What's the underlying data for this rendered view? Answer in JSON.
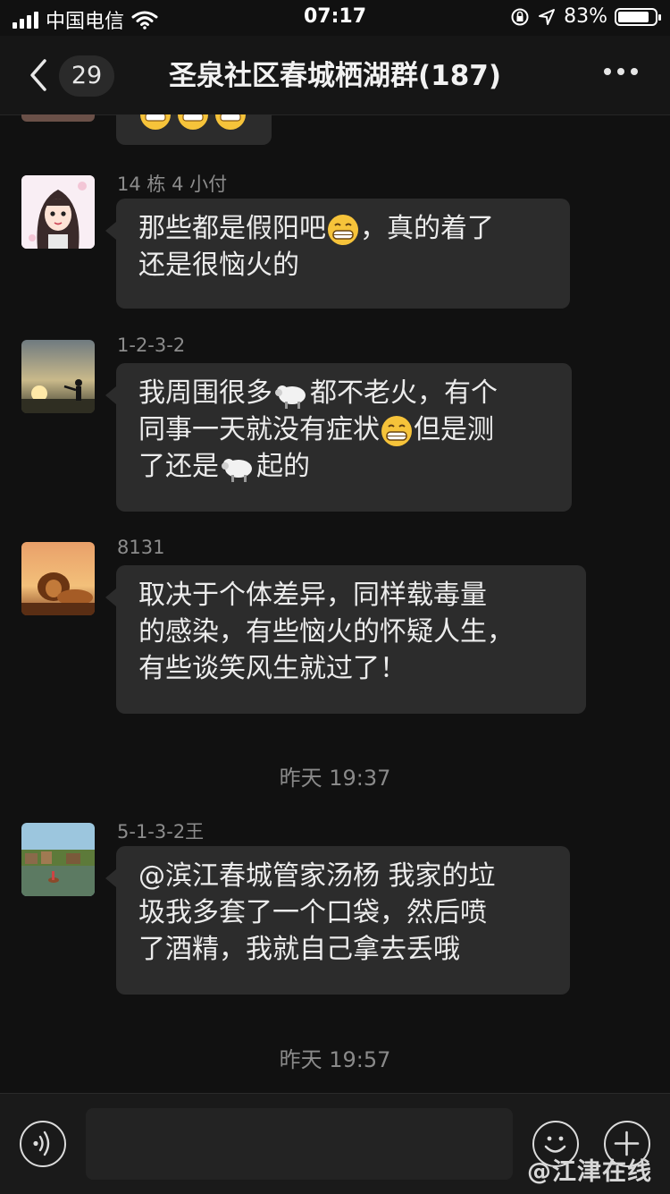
{
  "status_bar": {
    "carrier": "中国电信",
    "time": "07:17",
    "battery": "83%",
    "battery_level": 0.83
  },
  "nav": {
    "unread_count": "29",
    "title": "圣泉社区春城栖湖群(187)"
  },
  "messages": [
    {
      "sender": "14 栋 4 小付",
      "text_parts": [
        "那些都是假阳吧",
        "，真的着了\n还是很恼火的"
      ],
      "emoji": "grinning-face"
    },
    {
      "sender": "1-2-3-2",
      "text_parts": [
        "我周围很多",
        "都不老火，有个\n同事一天就没有症状",
        "但是测\n了还是",
        "起的"
      ],
      "emoji": [
        "sheep",
        "grinning-face",
        "sheep"
      ]
    },
    {
      "sender": "8131",
      "text": "取决于个体差异，同样载毒量\n的感染，有些恼火的怀疑人生，\n有些谈笑风生就过了！"
    },
    {
      "sender": "5-1-3-2王",
      "text": "@滨江春城管家汤杨 我家的垃\n圾我多套了一个口袋，然后喷\n了酒精，我就自己拿去丢哦"
    }
  ],
  "timestamps": [
    "昨天 19:37",
    "昨天 19:57"
  ],
  "watermark": "@江津在线",
  "colors": {
    "background": "#111111",
    "bubble": "#2c2c2c",
    "text": "#ececec",
    "secondary_text": "#8c8c8c"
  }
}
